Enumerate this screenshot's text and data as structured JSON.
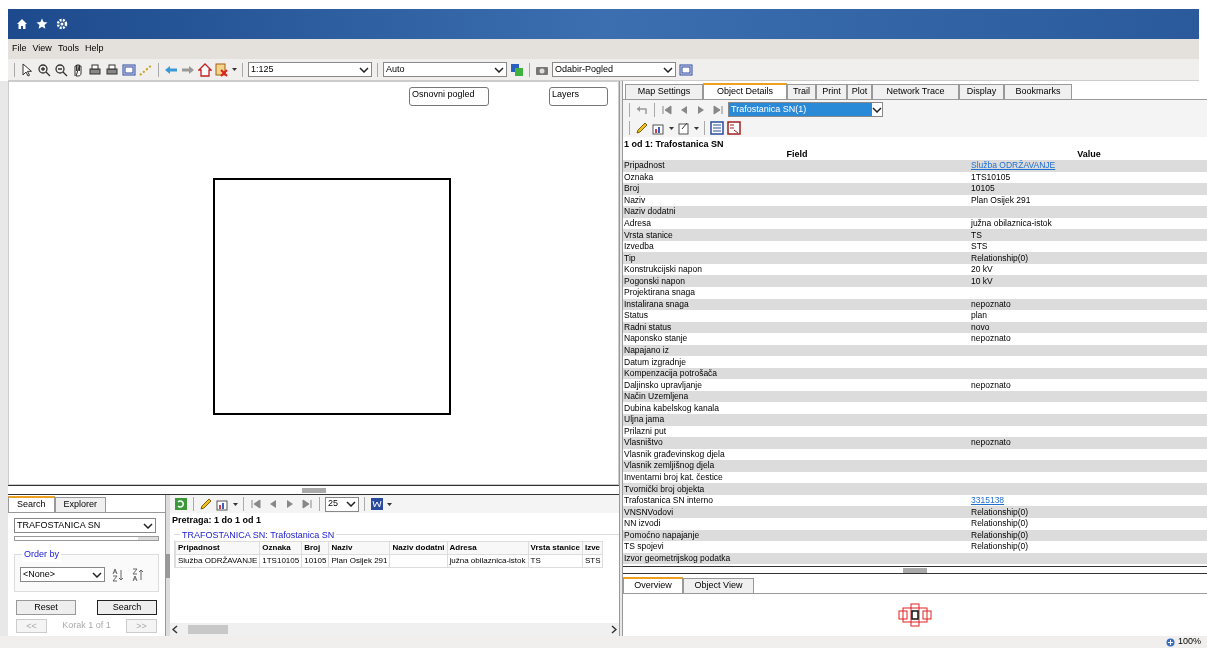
{
  "menu": [
    "File",
    "View",
    "Tools",
    "Help"
  ],
  "toolbar": {
    "scale": "1:125",
    "mode": "Auto",
    "view": "Odabir-Pogled"
  },
  "map": {
    "buttons": [
      "Osnovni pogled",
      "Layers"
    ]
  },
  "search_panel": {
    "tabs": [
      {
        "label": "Search",
        "selected": true
      },
      {
        "label": "Explorer",
        "selected": false
      }
    ],
    "layer": "TRAFOSTANICA SN",
    "progress": {
      "level": 0.86
    },
    "order_by_label": "Order by",
    "order_by": "<None>",
    "buttons": [
      "Reset",
      "Search"
    ],
    "prev": "<<",
    "step": "Korak 1 of 1",
    "next": ">>"
  },
  "results": {
    "page_size": "25",
    "summary": "Pretraga: 1 do 1 od 1",
    "group_title": "TRAFOSTANICA SN: Trafostanica SN",
    "columns": [
      "Pripadnost",
      "Oznaka",
      "Broj",
      "Naziv",
      "Naziv dodatni",
      "Adresa",
      "Vrsta stanice",
      "Izve"
    ],
    "rows": [
      [
        "Služba ODRŽAVANJE",
        "1TS10105",
        "10105",
        "Plan Osijek 291",
        "",
        "južna obilaznica-istok",
        "TS",
        "STS"
      ]
    ]
  },
  "tabs": [
    {
      "label": "Map Settings",
      "selected": false
    },
    {
      "label": "Object Details",
      "selected": true
    },
    {
      "label": "Trail",
      "selected": false
    },
    {
      "label": "Print",
      "selected": false
    },
    {
      "label": "Plot",
      "selected": false
    },
    {
      "label": "Network Trace",
      "selected": false
    },
    {
      "label": "Display",
      "selected": false
    },
    {
      "label": "Bookmarks",
      "selected": false
    }
  ],
  "details": {
    "object": "Trafostanica SN(1)",
    "title": "1 od 1: Trafostanica SN",
    "field_header": "Field",
    "value_header": "Value",
    "rows": [
      {
        "field": "Pripadnost",
        "value": "Služba ODRŽAVANJE",
        "kind": "link"
      },
      {
        "field": "Oznaka",
        "value": "1TS10105",
        "kind": "text"
      },
      {
        "field": "Broj",
        "value": "10105",
        "kind": "text"
      },
      {
        "field": "Naziv",
        "value": "Plan Osijek 291",
        "kind": "text"
      },
      {
        "field": "Naziv dodatni",
        "kind": "text"
      },
      {
        "field": "Adresa",
        "value": "južna obilaznica-istok",
        "kind": "text"
      },
      {
        "field": "Vrsta stanice",
        "value": "TS",
        "kind": "text"
      },
      {
        "field": "Izvedba",
        "value": "STS",
        "kind": "text"
      },
      {
        "field": "Tip",
        "value": "Relationship(0)",
        "kind": "text"
      },
      {
        "field": "Konstrukcijski napon",
        "value": "20 kV",
        "kind": "text"
      },
      {
        "field": "Pogonski napon",
        "value": "10 kV",
        "kind": "text"
      },
      {
        "field": "Projektirana snaga",
        "kind": "text"
      },
      {
        "field": "Instalirana snaga",
        "value": "nepoznato",
        "kind": "text"
      },
      {
        "field": "Status",
        "value": "plan",
        "kind": "text"
      },
      {
        "field": "Radni status",
        "value": "novo",
        "kind": "text"
      },
      {
        "field": "Naponsko stanje",
        "value": "nepoznato",
        "kind": "text"
      },
      {
        "field": "Napajano iz",
        "kind": "text"
      },
      {
        "field": "Datum izgradnje",
        "kind": "text"
      },
      {
        "field": "Kompenzacija potrošača",
        "kind": "text"
      },
      {
        "field": "Daljinsko upravljanje",
        "value": "nepoznato",
        "kind": "text"
      },
      {
        "field": "Način Uzemljena",
        "kind": "text"
      },
      {
        "field": "Dubina kabelskog kanala",
        "kind": "text"
      },
      {
        "field": "Uljna jama",
        "kind": "text"
      },
      {
        "field": "Prilazni put",
        "kind": "text"
      },
      {
        "field": "Vlasništvo",
        "value": "nepoznato",
        "kind": "text"
      },
      {
        "field": "Vlasnik građevinskog djela",
        "kind": "text"
      },
      {
        "field": "Vlasnik zemljišnog djela",
        "kind": "text"
      },
      {
        "field": "Inventarni broj kat. čestice",
        "kind": "text"
      },
      {
        "field": "Tvornički broj objekta",
        "kind": "text"
      },
      {
        "field": "Trafostanica SN interno",
        "value": "3315138",
        "kind": "link"
      },
      {
        "field": "VNSNVodovi",
        "value": "Relationship(0)",
        "kind": "text"
      },
      {
        "field": "NN izvodi",
        "value": "Relationship(0)",
        "kind": "text"
      },
      {
        "field": "Pomoćno napajanje",
        "value": "Relationship(0)",
        "kind": "text"
      },
      {
        "field": "TS spojevi",
        "value": "Relationship(0)",
        "kind": "text"
      },
      {
        "field": "Izvor geometrijskog podatka",
        "kind": "text"
      }
    ]
  },
  "overview_tabs": [
    {
      "label": "Overview",
      "selected": true
    },
    {
      "label": "Object View",
      "selected": false
    }
  ],
  "status_bar": {
    "zoom": "100%"
  }
}
